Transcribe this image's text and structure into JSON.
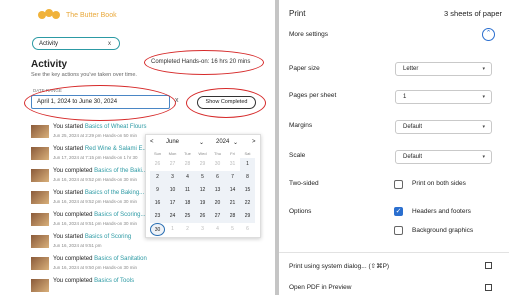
{
  "logo": {
    "text": "The Butter Book"
  },
  "activity": {
    "chip_label": "Activity",
    "chip_close": "x",
    "title": "Activity",
    "completed_summary": "Completed Hands-on: 16 hrs 20 mins",
    "subtitle": "See the key actions you've taken over time.",
    "date_range_label": "DATE RANGE",
    "date_range_value": "April 1, 2024 to June 30, 2024",
    "clear": "x",
    "show_completed": "Show Completed",
    "items": [
      {
        "verb": "You started",
        "course": "Basics of Wheat Flours",
        "meta": "Jun 25, 2024 at 2:29 pm  Hands-on 50 min"
      },
      {
        "verb": "You started",
        "course": "Red Wine & Salami E...",
        "meta": "Jun 17, 2024 at 7:15 pm  Hands-on 1 hr 30"
      },
      {
        "verb": "You completed",
        "course": "Basics of the Baki...",
        "meta": "Jun 16, 2024 at 9:52 pm  Hands-on 30 min"
      },
      {
        "verb": "You started",
        "course": "Basics of the Baking...",
        "meta": "Jun 16, 2024 at 9:52 pm  Hands-on 30 min"
      },
      {
        "verb": "You completed",
        "course": "Basics of Scoring...",
        "meta": "Jun 16, 2024 at 9:51 pm  Hands-on 30 min"
      },
      {
        "verb": "You started",
        "course": "Basics of Scoring",
        "meta": "Jun 16, 2024 at 9:51 pm"
      },
      {
        "verb": "You completed",
        "course": "Basics of Sanitation",
        "meta": "Jun 16, 2024 at 9:50 pm  Hands-on 30 min"
      },
      {
        "verb": "You completed",
        "course": "Basics of Tools",
        "meta": ""
      }
    ]
  },
  "calendar": {
    "prev": "<",
    "next": ">",
    "month": "June",
    "year": "2024",
    "dow": [
      "Sun",
      "Mon",
      "Tue",
      "Wed",
      "Thu",
      "Fri",
      "Sat"
    ],
    "weeks": [
      [
        "26",
        "27",
        "28",
        "29",
        "30",
        "31",
        "1"
      ],
      [
        "2",
        "3",
        "4",
        "5",
        "6",
        "7",
        "8"
      ],
      [
        "9",
        "10",
        "11",
        "12",
        "13",
        "14",
        "15"
      ],
      [
        "16",
        "17",
        "18",
        "19",
        "20",
        "21",
        "22"
      ],
      [
        "23",
        "24",
        "25",
        "26",
        "27",
        "28",
        "29"
      ],
      [
        "30",
        "1",
        "2",
        "3",
        "4",
        "5",
        "6"
      ]
    ]
  },
  "print": {
    "title": "Print",
    "sheets": "3 sheets of paper",
    "more_settings": "More settings",
    "paper_size_label": "Paper size",
    "paper_size_value": "Letter",
    "pages_per_sheet_label": "Pages per sheet",
    "pages_per_sheet_value": "1",
    "margins_label": "Margins",
    "margins_value": "Default",
    "scale_label": "Scale",
    "scale_value": "Default",
    "two_sided_label": "Two-sided",
    "print_both_sides": "Print on both sides",
    "options_label": "Options",
    "headers_footers": "Headers and footers",
    "background_graphics": "Background graphics",
    "system_dialog": "Print using system dialog... (⇧⌘P)",
    "open_pdf": "Open PDF in Preview"
  }
}
